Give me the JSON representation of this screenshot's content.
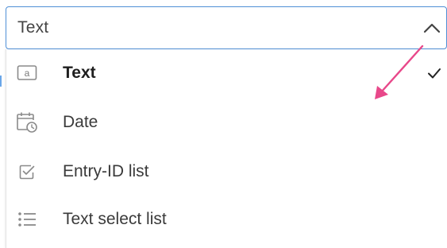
{
  "select": {
    "value": "Text",
    "chevron_icon": "chevron-up-icon"
  },
  "menu": {
    "items": [
      {
        "label": "Text",
        "icon": "text-field-icon",
        "selected": true
      },
      {
        "label": "Date",
        "icon": "calendar-clock-icon",
        "selected": false
      },
      {
        "label": "Entry-ID list",
        "icon": "checkbox-icon",
        "selected": false
      },
      {
        "label": "Text select list",
        "icon": "bulleted-list-icon",
        "selected": false
      }
    ],
    "check_icon": "checkmark-icon"
  },
  "annotation": {
    "arrow_color": "#e8488a"
  },
  "colors": {
    "focus_border": "#4f8fd6",
    "icon_gray": "#8a8a8a"
  }
}
